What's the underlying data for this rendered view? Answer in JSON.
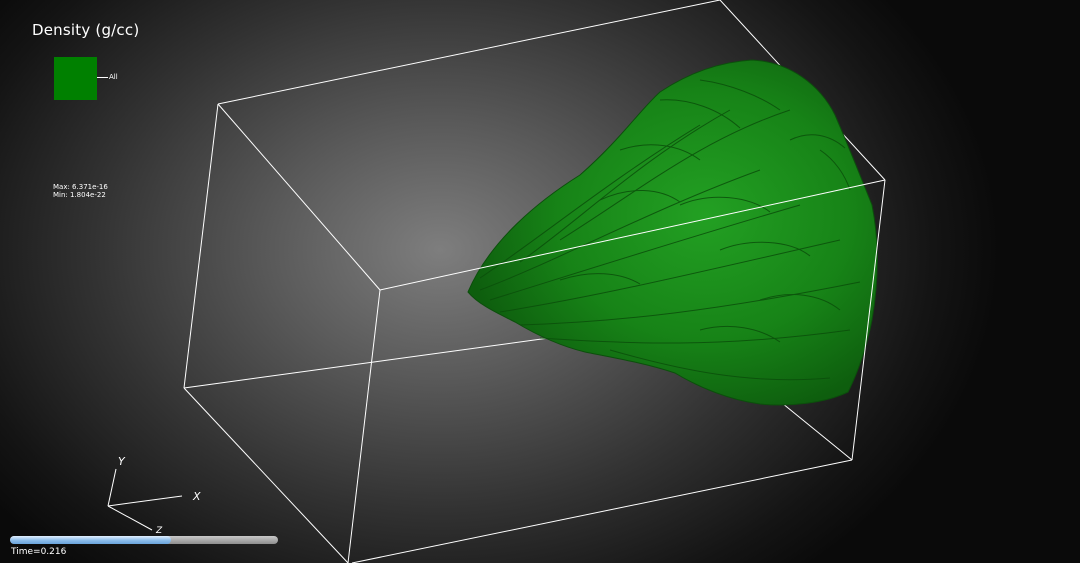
{
  "legend": {
    "title": "Density (g/cc)",
    "entry_label": "All",
    "swatch_color": "#008000",
    "max_text": "Max: 6.371e-16",
    "min_text": "Min: 1.804e-22"
  },
  "axes": {
    "x_label": "X",
    "y_label": "Y",
    "z_label": "Z"
  },
  "time": {
    "label": "Time=0.216",
    "slider_fraction": 0.6
  },
  "colors": {
    "surface": "#1f8f1f",
    "surface_dark": "#0b4d0b",
    "bounding_box": "#ffffff"
  }
}
